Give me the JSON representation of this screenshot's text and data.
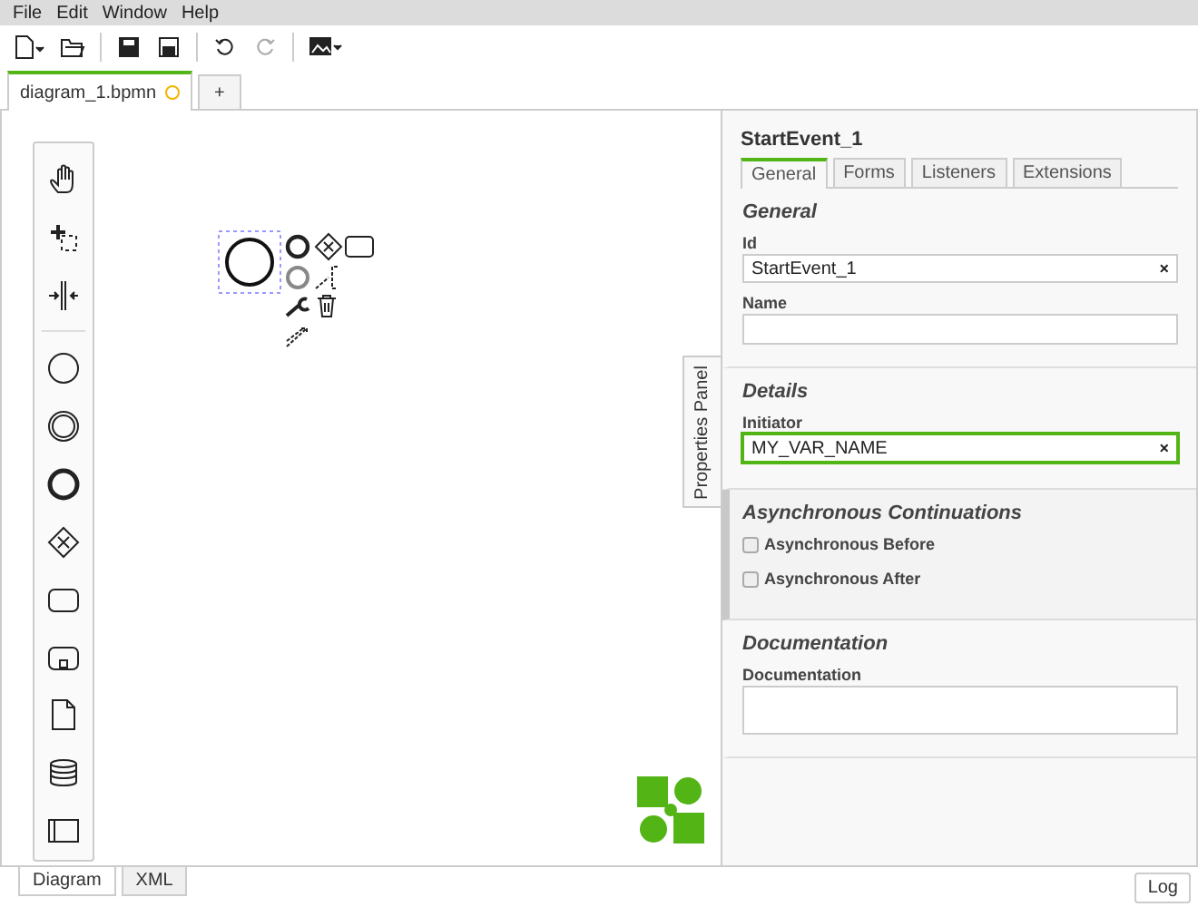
{
  "menu": [
    "File",
    "Edit",
    "Window",
    "Help"
  ],
  "file_tabs": [
    {
      "label": "diagram_1.bpmn",
      "selected": true,
      "unsaved": true
    },
    {
      "label": "+",
      "selected": false,
      "unsaved": false
    }
  ],
  "side_tab": "Properties Panel",
  "properties": {
    "title": "StartEvent_1",
    "tabs": [
      {
        "label": "General",
        "selected": true
      },
      {
        "label": "Forms",
        "selected": false
      },
      {
        "label": "Listeners",
        "selected": false
      },
      {
        "label": "Extensions",
        "selected": false
      }
    ],
    "sections": [
      {
        "title": "General",
        "hovered": false,
        "fields": [
          {
            "kind": "text",
            "label": "Id",
            "value": "StartEvent_1",
            "clear": "×",
            "focused": false
          },
          {
            "kind": "textarea",
            "label": "Name",
            "focused": false
          }
        ]
      },
      {
        "title": "Details",
        "hovered": false,
        "fields": [
          {
            "kind": "text",
            "label": "Initiator",
            "value": "MY_VAR_NAME",
            "clear": "×",
            "focused": true
          }
        ]
      },
      {
        "title": "Asynchronous Continuations",
        "hovered": true,
        "fields": [
          {
            "kind": "checkbox",
            "label": "Asynchronous Before",
            "checked": false
          },
          {
            "kind": "checkbox",
            "label": "Asynchronous After",
            "checked": false
          }
        ]
      },
      {
        "title": "Documentation",
        "hovered": false,
        "fields": [
          {
            "kind": "textarea",
            "label": "Documentation",
            "focused": false
          }
        ]
      }
    ]
  },
  "view_tabs": [
    {
      "label": "Diagram",
      "selected": true
    },
    {
      "label": "XML",
      "selected": false
    }
  ],
  "log_button": "Log"
}
